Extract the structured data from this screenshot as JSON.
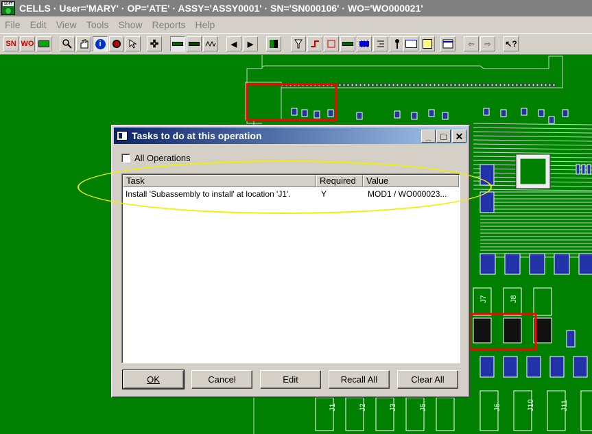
{
  "window": {
    "title": "CELLS · User='MARY' · OP='ATE' · ASSY='ASSY0001' · SN='SN000106' · WO='WO000021'",
    "icon_text": "SOFT"
  },
  "menu": [
    "File",
    "Edit",
    "View",
    "Tools",
    "Show",
    "Reports",
    "Help"
  ],
  "toolbar": {
    "sn_label": "SN",
    "wo_label": "WO",
    "info_label": "i",
    "help_label": "?",
    "arrow_left": "◀",
    "arrow_right": "▶",
    "move_label": "✜"
  },
  "board": {
    "labels": [
      "J7",
      "J8",
      "J1",
      "J2",
      "J3",
      "J5",
      "J6",
      "J10",
      "J11"
    ],
    "colors": {
      "background": "#008000",
      "trace": "#c8d8c8",
      "highlight": "#ff0000",
      "ellipse": "#f0f000"
    }
  },
  "dialog": {
    "title": "Tasks to do at this operation",
    "checkbox_label": "All Operations",
    "columns": [
      "Task",
      "Required",
      "Value"
    ],
    "rows": [
      {
        "task": "Install 'Subassembly to install' at location 'J1'.",
        "required": "Y",
        "value": "MOD1 / WO000023..."
      }
    ],
    "buttons": {
      "ok": "OK",
      "cancel": "Cancel",
      "edit": "Edit",
      "recall_all": "Recall All",
      "clear_all": "Clear All"
    },
    "window_buttons": {
      "minimize": "_",
      "maximize": "□",
      "close": "✕"
    }
  }
}
